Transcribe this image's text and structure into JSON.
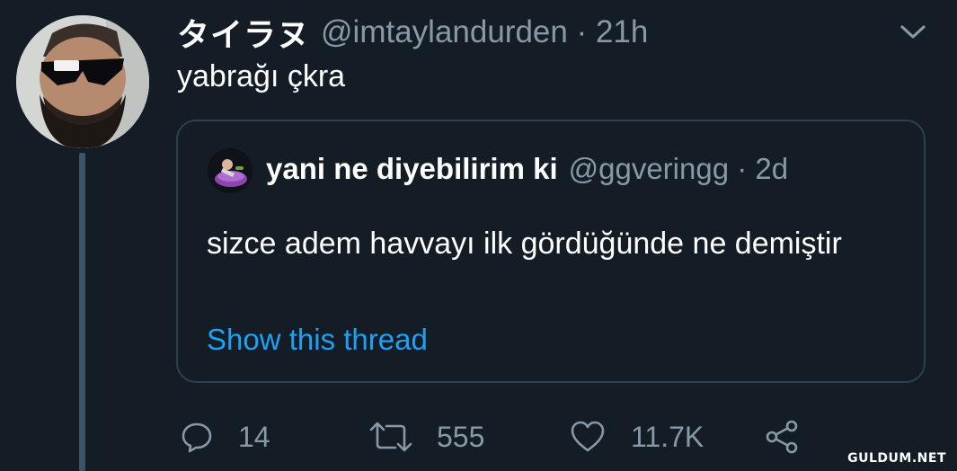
{
  "tweet": {
    "display_name": "タイラヌ",
    "handle_time": "@imtaylandurden · 21h",
    "text": "yabrağı çkra",
    "avatar_icon": "user-avatar-photo",
    "menu_icon": "chevron-down-icon"
  },
  "quote": {
    "display_name": "yani ne diyebilirim ki",
    "handle_time": "@ggveringg · 2d",
    "text": "sizce adem havvayı ilk gördüğünde ne demiştir",
    "show_thread": "Show this thread",
    "avatar_icon": "quoted-user-avatar"
  },
  "actions": {
    "replies": "14",
    "retweets": "555",
    "likes": "11.7K",
    "reply_icon": "reply-icon",
    "retweet_icon": "retweet-icon",
    "like_icon": "heart-icon",
    "share_icon": "share-icon"
  },
  "watermark": "GULDUM.NET",
  "colors": {
    "background": "#141d26",
    "secondary_text": "#8899a6",
    "link": "#1da1f2",
    "border": "#2f3f4f",
    "thread_line": "#3d5466"
  }
}
